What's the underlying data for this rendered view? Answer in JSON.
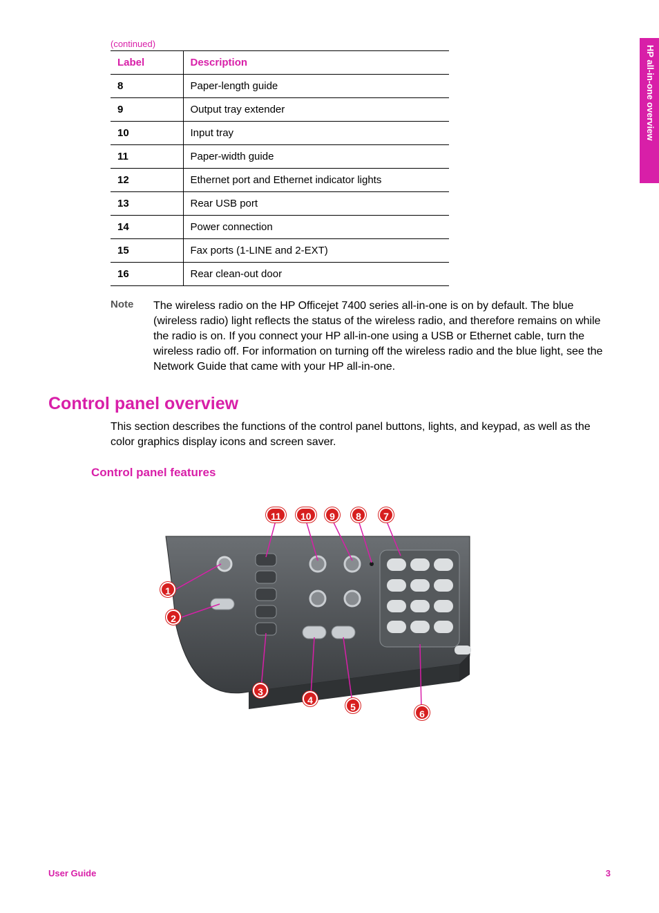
{
  "sideTab": "HP all-in-one overview",
  "continuedLabel": "(continued)",
  "table": {
    "headers": {
      "label": "Label",
      "description": "Description"
    },
    "rows": [
      {
        "label": "8",
        "desc": "Paper-length guide"
      },
      {
        "label": "9",
        "desc": "Output tray extender"
      },
      {
        "label": "10",
        "desc": "Input tray"
      },
      {
        "label": "11",
        "desc": "Paper-width guide"
      },
      {
        "label": "12",
        "desc": "Ethernet port and Ethernet indicator lights"
      },
      {
        "label": "13",
        "desc": "Rear USB port"
      },
      {
        "label": "14",
        "desc": "Power connection"
      },
      {
        "label": "15",
        "desc": "Fax ports (1-LINE and 2-EXT)"
      },
      {
        "label": "16",
        "desc": "Rear clean-out door"
      }
    ]
  },
  "note": {
    "label": "Note",
    "body": "The wireless radio on the HP Officejet 7400 series all-in-one is on by default. The blue (wireless radio) light reflects the status of the wireless radio, and therefore remains on while the radio is on. If you connect your HP all-in-one using a USB or Ethernet cable, turn the wireless radio off. For information on turning off the wireless radio and the blue light, see the Network Guide that came with your HP all-in-one."
  },
  "sectionTitle": "Control panel overview",
  "sectionIntro": "This section describes the functions of the control panel buttons, lights, and keypad, as well as the color graphics display icons and screen saver.",
  "subsectionTitle": "Control panel features",
  "callouts": [
    "1",
    "2",
    "3",
    "4",
    "5",
    "6",
    "7",
    "8",
    "9",
    "10",
    "11"
  ],
  "footer": {
    "left": "User Guide",
    "right": "3"
  }
}
